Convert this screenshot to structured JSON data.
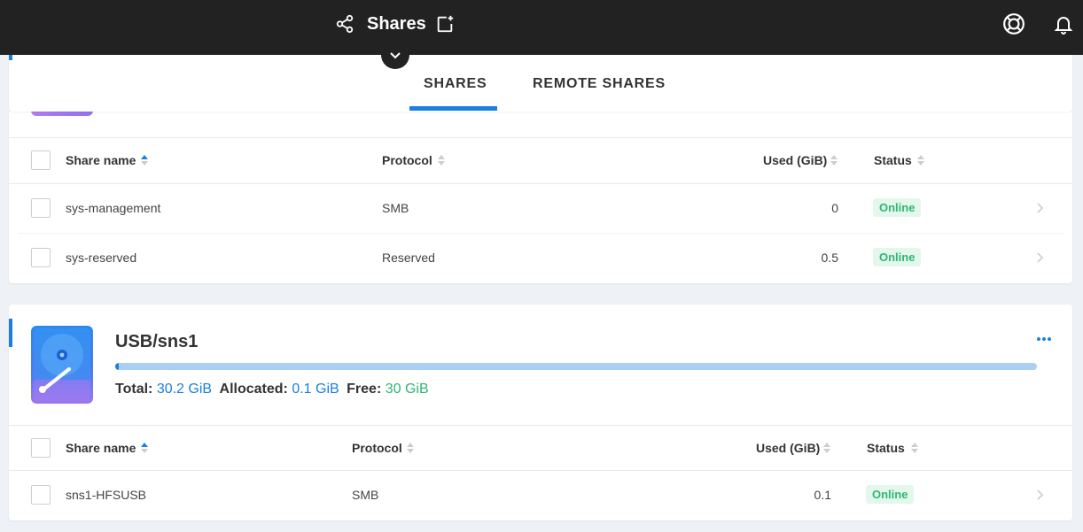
{
  "topbar": {
    "title": "Shares",
    "icons": {
      "share": "share-icon",
      "new_window": "new-window-icon",
      "help": "help-lifebuoy-icon",
      "notifications": "bell-icon"
    }
  },
  "tabs": [
    {
      "label": "SHARES",
      "active": true
    },
    {
      "label": "REMOTE SHARES",
      "active": false
    }
  ],
  "columns": {
    "share_name": "Share name",
    "protocol": "Protocol",
    "used": "Used (GiB)",
    "status": "Status"
  },
  "volume1": {
    "rows": [
      {
        "name": "sys-management",
        "protocol": "SMB",
        "used": "0",
        "status": "Online"
      },
      {
        "name": "sys-reserved",
        "protocol": "Reserved",
        "used": "0.5",
        "status": "Online"
      }
    ]
  },
  "volume2": {
    "name": "USB/sns1",
    "usage_fraction": 0.003,
    "total_label": "Total:",
    "total_value": "30.2 GiB",
    "allocated_label": "Allocated:",
    "allocated_value": "0.1 GiB",
    "free_label": "Free:",
    "free_value": "30 GiB",
    "rows": [
      {
        "name": "sns1-HFSUSB",
        "protocol": "SMB",
        "used": "0.1",
        "status": "Online"
      }
    ]
  },
  "colors": {
    "accent": "#1a7fe0",
    "online": "#2fb673",
    "topbar": "#222222"
  }
}
